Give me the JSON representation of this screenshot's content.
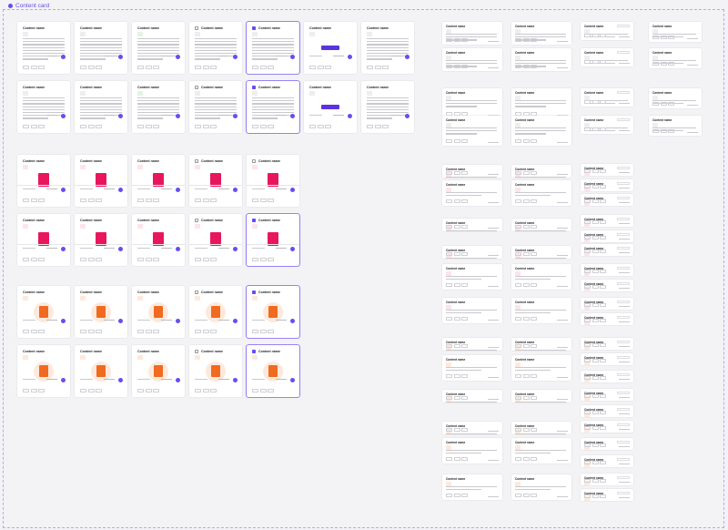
{
  "header": {
    "title": "Content card"
  },
  "card": {
    "title": "Content name"
  }
}
